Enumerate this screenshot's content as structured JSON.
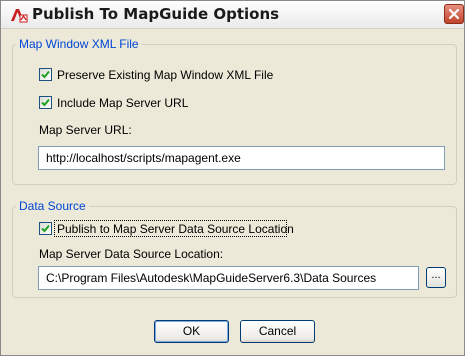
{
  "window": {
    "title": "Publish To MapGuide Options"
  },
  "map_window_group": {
    "legend": "Map Window XML File",
    "preserve_checkbox": {
      "label": "Preserve Existing Map Window XML File",
      "checked": true
    },
    "include_url_checkbox": {
      "label": "Include Map Server URL",
      "checked": true
    },
    "url_label": "Map Server URL:",
    "url_value": "http://localhost/scripts/mapagent.exe"
  },
  "data_source_group": {
    "legend": "Data Source",
    "publish_checkbox": {
      "label": "Publish to Map Server Data Source Location",
      "checked": true
    },
    "location_label": "Map Server Data Source Location:",
    "location_value": "C:\\Program Files\\Autodesk\\MapGuideServer6.3\\Data Sources",
    "browse_label": "..."
  },
  "buttons": {
    "ok_label": "OK",
    "cancel_label": "Cancel"
  },
  "colors": {
    "legend_text": "#0046d5",
    "close_button": "#c0442b",
    "dialog_background": "#ece9d8"
  },
  "icons": {
    "app_icon": "autocad-app-icon",
    "close": "close-icon",
    "checkmark": "checkmark-icon"
  }
}
